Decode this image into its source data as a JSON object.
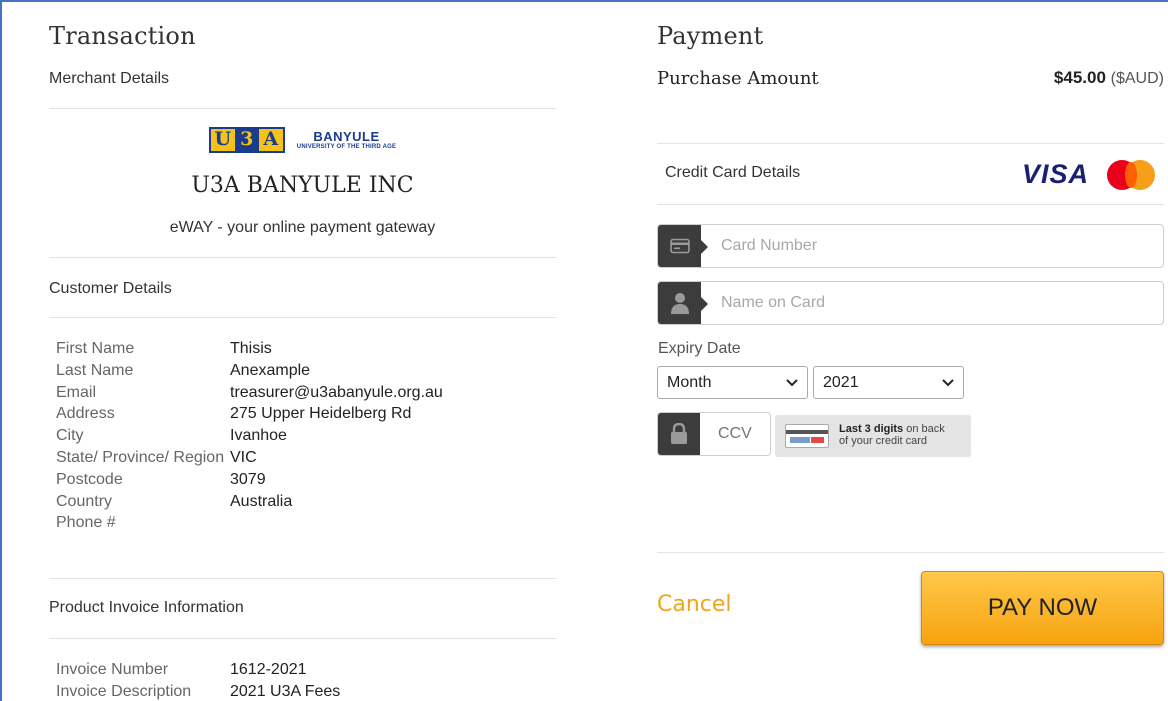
{
  "transaction": {
    "heading": "Transaction",
    "merchant_details_label": "Merchant Details",
    "logo": {
      "letters": [
        "U",
        "3",
        "A"
      ],
      "line1": "BANYULE",
      "line2": "UNIVERSITY OF THE THIRD AGE"
    },
    "merchant_name": "U3A BANYULE INC",
    "gateway_text": "eWAY - your online payment gateway",
    "customer_details_label": "Customer Details",
    "customer": [
      {
        "key": "First Name",
        "value": "Thisis"
      },
      {
        "key": "Last Name",
        "value": "Anexample"
      },
      {
        "key": "Email",
        "value": "treasurer@u3abanyule.org.au"
      },
      {
        "key": "Address",
        "value": "275 Upper Heidelberg Rd"
      },
      {
        "key": "City",
        "value": "Ivanhoe"
      },
      {
        "key": "State/ Province/ Region",
        "value": "VIC"
      },
      {
        "key": "Postcode",
        "value": "3079"
      },
      {
        "key": "Country",
        "value": "Australia"
      },
      {
        "key": "Phone #",
        "value": ""
      }
    ],
    "product_invoice_label": "Product Invoice Information",
    "invoice": [
      {
        "key": "Invoice Number",
        "value": "1612-2021"
      },
      {
        "key": "Invoice Description",
        "value": "2021 U3A Fees"
      }
    ]
  },
  "payment": {
    "heading": "Payment",
    "purchase_amount_label": "Purchase Amount",
    "amount": "$45.00",
    "currency": "($AUD)",
    "credit_card_label": "Credit Card Details",
    "visa_text": "VISA",
    "card_number_placeholder": "Card Number",
    "name_on_card_placeholder": "Name on Card",
    "expiry_label": "Expiry Date",
    "month_selected": "Month",
    "year_selected": "2021",
    "ccv_placeholder": "CCV",
    "ccv_hint_bold": "Last 3 digits",
    "ccv_hint_rest1": " on back",
    "ccv_hint_rest2": "of your credit card",
    "cancel_label": "Cancel",
    "pay_now_label": "PAY NOW"
  },
  "colors": {
    "accent": "#f0a61b",
    "pay_button": "#f7a30f",
    "addon": "#3c3c3c",
    "visa": "#1a1f71",
    "frame_border": "#4a72c4"
  },
  "icons": {
    "card_number": "credit-card-icon",
    "name_on_card": "user-icon",
    "ccv": "lock-icon",
    "select": "chevron-down-icon"
  }
}
